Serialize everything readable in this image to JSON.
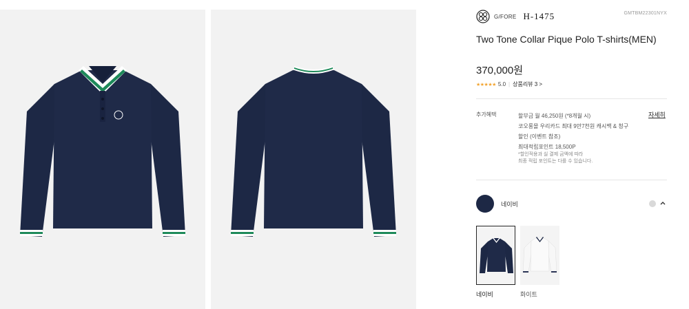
{
  "brand": {
    "name": "G/FORE",
    "sub_logo": "H-1475",
    "sku": "GMTBM22301NYX"
  },
  "product": {
    "title": "Two Tone Collar Pique Polo T-shirts(MEN)",
    "price": "370,000원",
    "rating": {
      "stars": "★★★★★",
      "score": "5.0",
      "reviews_link": "상품리뷰 3 >"
    }
  },
  "benefits": {
    "label": "추가혜택",
    "lines": [
      "할부금 월 46,250원 (*8개월 시)",
      "코오롱몰 우리카드 최대 9만7천원 캐시백 & 청구",
      "할인 (이벤트 참조)",
      "최대적립포인트 18,500P"
    ],
    "note_lines": [
      "*할인적용과 실 결제 금액에 따라",
      "최종 적립 포인트는 다를 수 있습니다."
    ],
    "detail_link": "자세히"
  },
  "color_selector": {
    "selected_name": "네이비",
    "swatch_color": "#1d2845",
    "options": [
      {
        "label": "네이비"
      },
      {
        "label": "화이트"
      }
    ]
  },
  "colors": {
    "navy": "#1d2845",
    "green": "#1e8a5a",
    "star": "#f2a431"
  }
}
